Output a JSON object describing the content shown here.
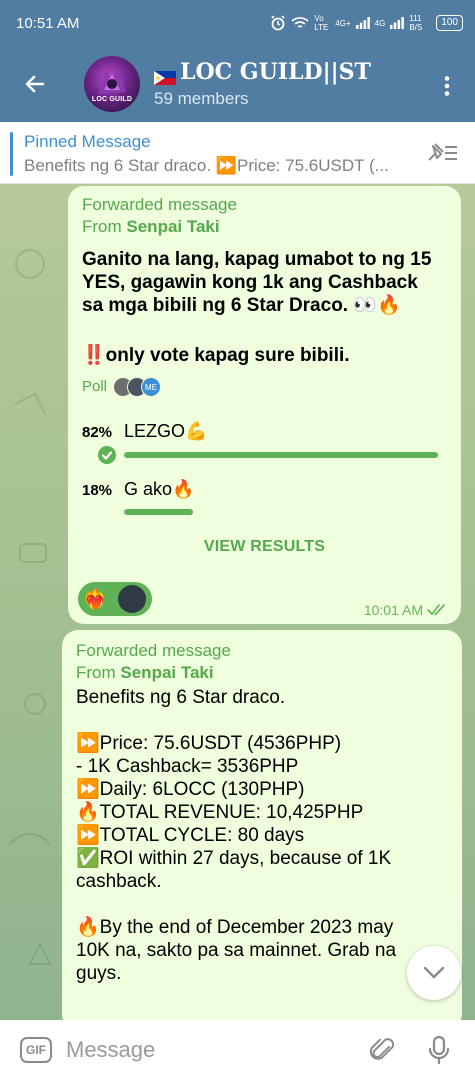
{
  "status_bar": {
    "time": "10:51 AM",
    "signal_a": "Vo LTE",
    "signal_b": "4G+",
    "signal_c": "4G",
    "speed": "111 B/S",
    "battery": "100"
  },
  "header": {
    "title": "LOC GUILD||ST",
    "subtitle": "59 members",
    "avatar_text": "LOC GUILD"
  },
  "pinned": {
    "title": "Pinned Message",
    "text": "Benefits ng 6 Star draco. ⏩Price: 75.6USDT (..."
  },
  "messages": [
    {
      "forwarded_label": "Forwarded message",
      "from_prefix": "From ",
      "from_name": "Senpai Taki",
      "text_1": "Ganito na lang, kapag umabot to ng 15 YES, gagawin kong 1k ang Cashback sa mga bibili ng 6 Star Draco. 👀🔥",
      "text_2": "‼️only vote kapag sure bibili.",
      "poll_label": "Poll",
      "voter_me": "ME",
      "options": [
        {
          "percent": "82%",
          "label": "LEZGO💪",
          "fraction": 0.82,
          "chosen": true
        },
        {
          "percent": "18%",
          "label": "G ako🔥",
          "fraction": 0.18,
          "chosen": false
        }
      ],
      "view_results": "VIEW RESULTS",
      "reaction_emoji": "❤️‍🔥",
      "time": "10:01 AM"
    },
    {
      "forwarded_label": "Forwarded message",
      "from_prefix": "From ",
      "from_name": "Senpai Taki",
      "lines": [
        "Benefits ng 6 Star draco.",
        "",
        "⏩Price: 75.6USDT (4536PHP)",
        "- 1K Cashback= 3536PHP",
        "⏩Daily: 6LOCC (130PHP)",
        "🔥TOTAL REVENUE: 10,425PHP",
        "⏩TOTAL CYCLE: 80 days",
        "✅ROI within 27 days, because of 1K cashback.",
        "",
        "🔥By the end of December 2023 may 10K na, sakto pa sa mainnet. Grab na guys."
      ]
    }
  ],
  "input": {
    "gif_label": "GIF",
    "placeholder": "Message"
  },
  "colors": {
    "header_bg": "#517da2",
    "bubble_bg": "#effedd",
    "accent_green": "#5fb255",
    "link_blue": "#3d8fd8"
  }
}
